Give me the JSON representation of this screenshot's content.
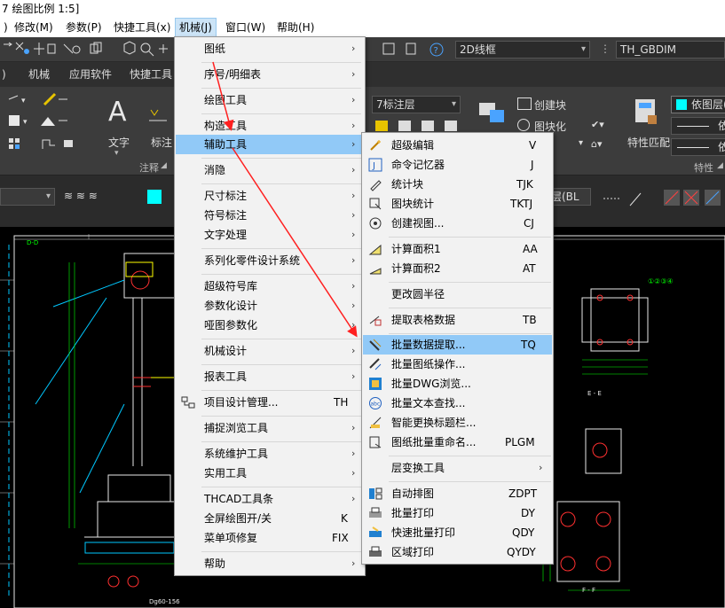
{
  "window": {
    "title": "7 绘图比例 1:5]"
  },
  "menubar": {
    "items": [
      {
        "label": "修改(M)"
      },
      {
        "label": "参数(P)"
      },
      {
        "label": "快捷工具(x)"
      },
      {
        "label": "机械(J)"
      },
      {
        "label": "窗口(W)"
      },
      {
        "label": "帮助(H)"
      }
    ],
    "left_fragment": ")"
  },
  "toolbar": {
    "view_style": "2D线框",
    "dimstyle": "TH_GBDIM"
  },
  "ribbon": {
    "tabs": [
      ")",
      "机械",
      "应用软件",
      "快捷工具"
    ],
    "text_button": "文字",
    "label_button": "标注",
    "group_annotation": "注释",
    "group_properties": "特性",
    "dimstyle_combo": "7标注层",
    "create_block": "创建块",
    "block_insert": "图块化",
    "layer_combo": "依图层(",
    "match_props": "特性匹配",
    "line_a": "依",
    "line_b": "依",
    "layer_strip_combo": "层(BL",
    "strip_combo_left": "",
    "layer_strip_color": "#00ffff"
  },
  "menu_main": {
    "items": [
      {
        "label": "图纸",
        "shortcut": "",
        "submenu": true
      },
      {
        "label": "序号/明细表",
        "shortcut": "",
        "submenu": true
      },
      {
        "label": "绘图工具",
        "shortcut": "",
        "submenu": true
      },
      {
        "label": "构造工具",
        "shortcut": "",
        "submenu": true
      },
      {
        "label": "辅助工具",
        "shortcut": "",
        "submenu": true,
        "highlighted": true
      },
      {
        "label": "消隐",
        "shortcut": "",
        "submenu": true
      },
      {
        "label": "尺寸标注",
        "shortcut": "",
        "submenu": true
      },
      {
        "label": "符号标注",
        "shortcut": "",
        "submenu": true
      },
      {
        "label": "文字处理",
        "shortcut": "",
        "submenu": true
      },
      {
        "label": "系列化零件设计系统",
        "shortcut": "",
        "submenu": true
      },
      {
        "label": "超级符号库",
        "shortcut": "",
        "submenu": true
      },
      {
        "label": "参数化设计",
        "shortcut": "",
        "submenu": true
      },
      {
        "label": "哑图参数化",
        "shortcut": "",
        "submenu": true
      },
      {
        "label": "机械设计",
        "shortcut": "",
        "submenu": true
      },
      {
        "label": "报表工具",
        "shortcut": "",
        "submenu": true
      },
      {
        "label": "项目设计管理...",
        "shortcut": "TH",
        "submenu": false
      },
      {
        "label": "捕捉浏览工具",
        "shortcut": "",
        "submenu": true
      },
      {
        "label": "系统维护工具",
        "shortcut": "",
        "submenu": true
      },
      {
        "label": "实用工具",
        "shortcut": "",
        "submenu": true
      },
      {
        "label": "THCAD工具条",
        "shortcut": "",
        "submenu": true
      },
      {
        "label": "全屏绘图开/关",
        "shortcut": "K",
        "submenu": false
      },
      {
        "label": "菜单项修复",
        "shortcut": "FIX",
        "submenu": false
      },
      {
        "label": "帮助",
        "shortcut": "",
        "submenu": true
      }
    ]
  },
  "menu_sub": {
    "items": [
      {
        "label": "超级编辑",
        "shortcut": "V"
      },
      {
        "label": "命令记忆器",
        "shortcut": "J"
      },
      {
        "label": "统计块",
        "shortcut": "TJK"
      },
      {
        "label": "图块统计",
        "shortcut": "TKTJ"
      },
      {
        "label": "创建视图...",
        "shortcut": "CJ"
      },
      {
        "label": "计算面积1",
        "shortcut": "AA"
      },
      {
        "label": "计算面积2",
        "shortcut": "AT"
      },
      {
        "label": "更改圆半径",
        "shortcut": ""
      },
      {
        "label": "提取表格数据",
        "shortcut": "TB"
      },
      {
        "label": "批量数据提取...",
        "shortcut": "TQ",
        "highlighted": true
      },
      {
        "label": "批量图纸操作...",
        "shortcut": ""
      },
      {
        "label": "批量DWG浏览...",
        "shortcut": ""
      },
      {
        "label": "批量文本查找...",
        "shortcut": ""
      },
      {
        "label": "智能更换标题栏...",
        "shortcut": ""
      },
      {
        "label": "图纸批量重命名...",
        "shortcut": "PLGM"
      },
      {
        "label": "层变换工具",
        "shortcut": "",
        "submenu": true
      },
      {
        "label": "自动排图",
        "shortcut": "ZDPT"
      },
      {
        "label": "批量打印",
        "shortcut": "DY"
      },
      {
        "label": "快速批量打印",
        "shortcut": "QDY"
      },
      {
        "label": "区域打印",
        "shortcut": "QYDY"
      }
    ]
  },
  "drawing": {
    "label_tl": "D-D",
    "label_ee": "E - E",
    "label_ff": "F - F",
    "label_bottom": "Dg60-156",
    "label_circles": "①②③④"
  }
}
